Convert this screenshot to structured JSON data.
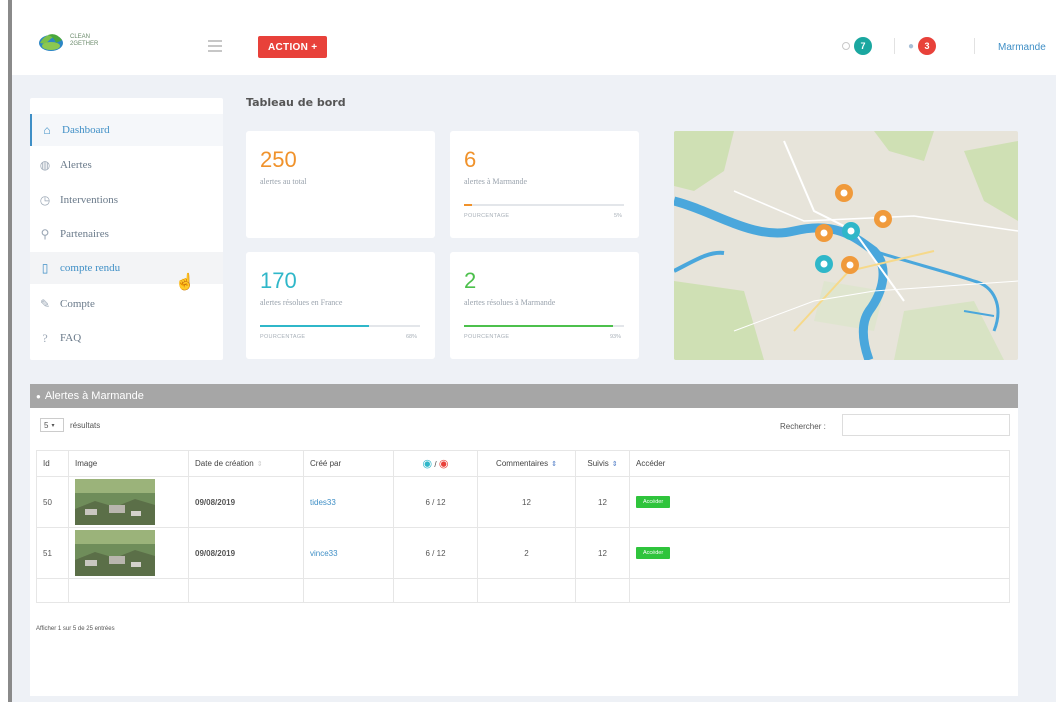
{
  "header": {
    "logo_line1": "CLEAN",
    "logo_line2": "2GETHER",
    "action_label": "ACTION +",
    "notif_count_1": "7",
    "notif_count_2": "3",
    "user_name": "Marmande",
    "colors": {
      "action": "#e8413a",
      "badge_teal": "#1aa7a0",
      "badge_red": "#e8413a"
    }
  },
  "sidebar": {
    "items": [
      {
        "label": "Dashboard",
        "icon": "home-icon"
      },
      {
        "label": "Alertes",
        "icon": "globe-icon"
      },
      {
        "label": "Interventions",
        "icon": "clock-icon"
      },
      {
        "label": "Partenaires",
        "icon": "user-icon"
      },
      {
        "label": "compte rendu",
        "icon": "document-icon"
      },
      {
        "label": "Compte",
        "icon": "pencil-icon"
      },
      {
        "label": "FAQ",
        "icon": "help-icon"
      }
    ]
  },
  "page": {
    "title": "Tableau de bord"
  },
  "stats": [
    {
      "value": "250",
      "label": "alertes au total",
      "color": "#f0922b"
    },
    {
      "value": "6",
      "label": "alertes à Marmande",
      "color": "#f0922b",
      "progress_label": "POURCENTAGE",
      "progress_pct": "5%",
      "progress": 0.05
    },
    {
      "value": "170",
      "label": "alertes résolues en France",
      "color": "#2fb7c9",
      "progress_label": "POURCENTAGE",
      "progress_pct": "68%",
      "progress": 0.68
    },
    {
      "value": "2",
      "label": "alertes résolues à Marmande",
      "color": "#4cc04c",
      "progress_label": "POURCENTAGE",
      "progress_pct": "93%",
      "progress": 0.93
    }
  ],
  "panel": {
    "title": "Alertes à Marmande",
    "length_value": "5",
    "length_suffix": "résultats",
    "search_label": "Rechercher :",
    "columns": [
      "Id",
      "Image",
      "Date de création",
      "Créé par",
      "/",
      "Commentaires",
      "Suivis",
      "Accéder"
    ],
    "rows": [
      {
        "id": "50",
        "date": "09/08/2019",
        "author": "tides33",
        "seen": "6",
        "sep": "/",
        "total": "12",
        "comments": "12",
        "follows": "12",
        "action": "Accéder"
      },
      {
        "id": "51",
        "date": "09/08/2019",
        "author": "vince33",
        "seen": "6",
        "sep": "/",
        "total": "12",
        "comments": "2",
        "follows": "12",
        "action": "Accéder"
      }
    ],
    "footer": "Afficher 1 sur 5 de 25 entrées"
  }
}
